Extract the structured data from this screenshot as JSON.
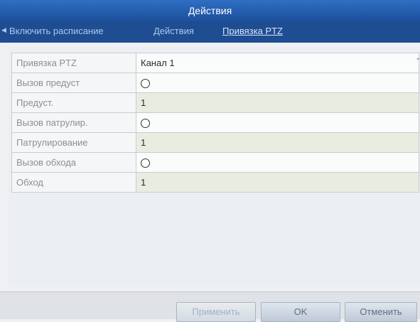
{
  "window": {
    "title": "Действия"
  },
  "tabs": [
    {
      "label": "Включить расписание"
    },
    {
      "label": "Действия"
    },
    {
      "label": "Привязка PTZ"
    }
  ],
  "rows": [
    {
      "label": "Привязка PTZ",
      "value": "Канал 1"
    },
    {
      "label": "Вызов предуст",
      "value": ""
    },
    {
      "label": "Предуст.",
      "value": "1"
    },
    {
      "label": "Вызов патрулир.",
      "value": ""
    },
    {
      "label": "Патрулирование",
      "value": "1"
    },
    {
      "label": "Вызов обхода",
      "value": ""
    },
    {
      "label": "Обход",
      "value": "1"
    }
  ],
  "buttons": {
    "apply": "Применить",
    "ok": "OK",
    "cancel": "Отменить"
  }
}
